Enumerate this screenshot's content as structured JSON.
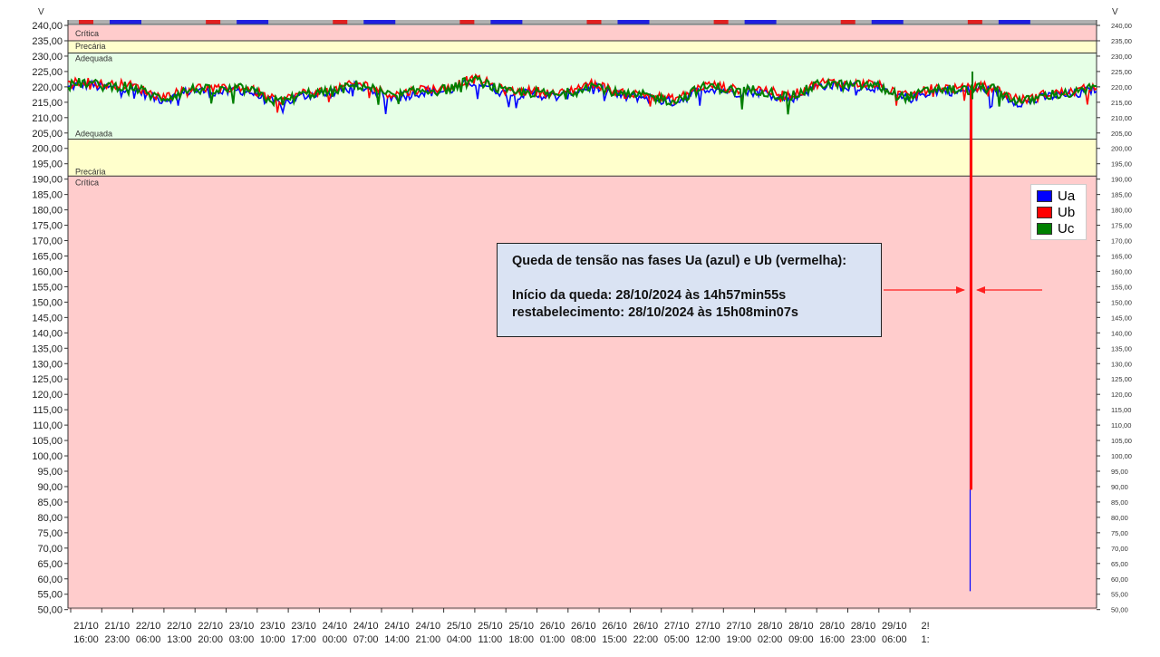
{
  "chart_data": {
    "type": "line",
    "y_unit_left": "V",
    "y_unit_right": "V",
    "ylim": [
      50,
      240
    ],
    "y_ticks_left": [
      "240,00",
      "235,00",
      "230,00",
      "225,00",
      "220,00",
      "215,00",
      "210,00",
      "205,00",
      "200,00",
      "195,00",
      "190,00",
      "185,00",
      "180,00",
      "175,00",
      "170,00",
      "165,00",
      "160,00",
      "155,00",
      "150,00",
      "145,00",
      "140,00",
      "135,00",
      "130,00",
      "125,00",
      "120,00",
      "115,00",
      "110,00",
      "105,00",
      "100,00",
      "95,00",
      "90,00",
      "85,00",
      "80,00",
      "75,00",
      "70,00",
      "65,00",
      "60,00",
      "55,00",
      "50,00"
    ],
    "y_ticks_right": [
      "240,00",
      "235,00",
      "230,00",
      "225,00",
      "220,00",
      "215,00",
      "210,00",
      "205,00",
      "200,00",
      "195,00",
      "190,00",
      "185,00",
      "180,00",
      "175,00",
      "170,00",
      "165,00",
      "160,00",
      "155,00",
      "150,00",
      "145,00",
      "140,00",
      "135,00",
      "130,00",
      "125,00",
      "120,00",
      "115,00",
      "110,00",
      "105,00",
      "100,00",
      "95,00",
      "90,00",
      "85,00",
      "80,00",
      "75,00",
      "70,00",
      "65,00",
      "60,00",
      "55,00",
      "50,00"
    ],
    "x_ticks": [
      {
        "date": "21/10",
        "time": "16:00"
      },
      {
        "date": "21/10",
        "time": "23:00"
      },
      {
        "date": "22/10",
        "time": "06:00"
      },
      {
        "date": "22/10",
        "time": "13:00"
      },
      {
        "date": "22/10",
        "time": "20:00"
      },
      {
        "date": "23/10",
        "time": "03:00"
      },
      {
        "date": "23/10",
        "time": "10:00"
      },
      {
        "date": "23/10",
        "time": "17:00"
      },
      {
        "date": "24/10",
        "time": "00:00"
      },
      {
        "date": "24/10",
        "time": "07:00"
      },
      {
        "date": "24/10",
        "time": "14:00"
      },
      {
        "date": "24/10",
        "time": "21:00"
      },
      {
        "date": "25/10",
        "time": "04:00"
      },
      {
        "date": "25/10",
        "time": "11:00"
      },
      {
        "date": "25/10",
        "time": "18:00"
      },
      {
        "date": "26/10",
        "time": "01:00"
      },
      {
        "date": "26/10",
        "time": "08:00"
      },
      {
        "date": "26/10",
        "time": "15:00"
      },
      {
        "date": "26/10",
        "time": "22:00"
      },
      {
        "date": "27/10",
        "time": "05:00"
      },
      {
        "date": "27/10",
        "time": "12:00"
      },
      {
        "date": "27/10",
        "time": "19:00"
      },
      {
        "date": "28/10",
        "time": "02:00"
      },
      {
        "date": "28/10",
        "time": "09:00"
      },
      {
        "date": "28/10",
        "time": "16:00"
      },
      {
        "date": "28/10",
        "time": "23:00"
      },
      {
        "date": "29/10",
        "time": "06:00"
      },
      {
        "date": "2!",
        "time": "1:"
      }
    ],
    "bands": [
      {
        "label": "Crítica",
        "from": 235,
        "to": 240,
        "color": "#ffcccc"
      },
      {
        "label": "Precária",
        "from": 231,
        "to": 235,
        "color": "#ffffcc"
      },
      {
        "label": "Adequada",
        "from": 203,
        "to": 231,
        "color": "#e6ffe6"
      },
      {
        "label": "Adequada",
        "from": 203,
        "to": 203,
        "color": "#e6ffe6"
      },
      {
        "label": "Precária",
        "from": 191,
        "to": 203,
        "color": "#ffffcc"
      },
      {
        "label": "Crítica",
        "from": 50,
        "to": 191,
        "color": "#ffcccc"
      }
    ],
    "series": [
      {
        "name": "Ua",
        "color": "#0000ff"
      },
      {
        "name": "Ub",
        "color": "#ff0000"
      },
      {
        "name": "Uc",
        "color": "#008000"
      }
    ],
    "baseline_v": 218.5,
    "event": {
      "drop_min_ua": 56,
      "drop_min_ub": 89,
      "spike_max_uc": 225
    },
    "grid": false,
    "legend_position": "right"
  },
  "annotation": {
    "line1": "Queda de tensão nas fases Ua (azul) e Ub (vermelha):",
    "line2": "Início da queda: 28/10/2024 às 14h57min55s",
    "line3": "restabelecimento: 28/10/2024 às 15h08min07s"
  },
  "legend": {
    "ua": "Ua",
    "ub": "Ub",
    "uc": "Uc"
  }
}
